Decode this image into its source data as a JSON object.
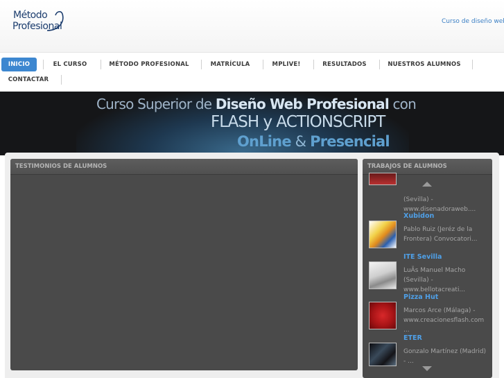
{
  "header": {
    "logo_line1": "Método",
    "logo_line2": "Profesional",
    "logo_mark": "®",
    "top_link": "Curso de diseño web"
  },
  "nav": {
    "items": [
      {
        "label": "INICIO",
        "active": true
      },
      {
        "label": "EL CURSO"
      },
      {
        "label": "MÉTODO PROFESIONAL"
      },
      {
        "label": "MATRÍCULA"
      },
      {
        "label": "MPLIVE!"
      },
      {
        "label": "RESULTADOS"
      },
      {
        "label": "NUESTROS ALUMNOS"
      },
      {
        "label": "CONTACTAR"
      }
    ]
  },
  "banner": {
    "line1_prefix": "Curso Superior de ",
    "line1_bold": "Diseño Web Profesional",
    "line1_suffix": " con",
    "line2": "FLASH y ACTIONSCRIPT",
    "line3_a": "OnLine",
    "line3_amp": " & ",
    "line3_b": "Presencial"
  },
  "testimonials": {
    "title": "TESTIMONIOS DE ALUMNOS"
  },
  "works": {
    "title": "TRABAJOS DE ALUMNOS",
    "partial_top_desc": "(Sevilla) - www.disenadoraweb....",
    "items": [
      {
        "title": "Xubidon",
        "desc": "Pablo Ruiz (Jeréz de la Frontera) Convocatori..."
      },
      {
        "title": "ITE Sevilla",
        "desc": "LuÃs Manuel Macho (Sevilla) - www.bellotacreati..."
      },
      {
        "title": "Pizza Hut",
        "desc": "Marcos Arce (Málaga) - www.creacionesflash.com ..."
      },
      {
        "title": "ETER",
        "desc": "Gonzalo Martínez (Madrid) - ..."
      }
    ]
  },
  "colors": {
    "accent": "#3d87d0",
    "link": "#3b7fc4",
    "job_title": "#4fa0e8",
    "panel": "#4a4a4a"
  }
}
